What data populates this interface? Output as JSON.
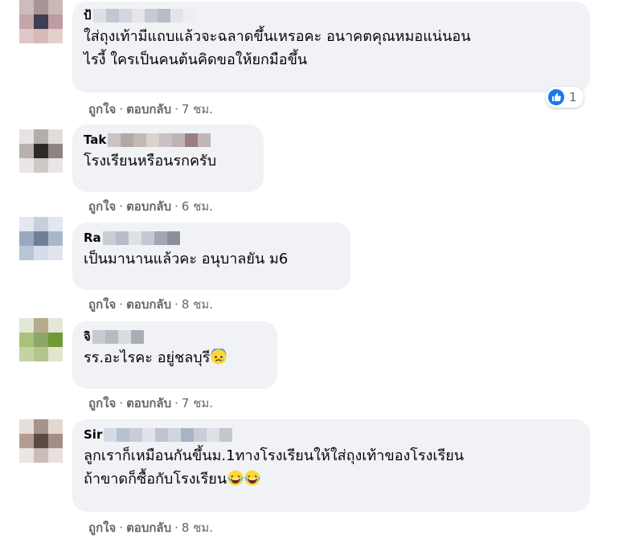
{
  "comments": [
    {
      "name": "ป้",
      "text_line1": "ใส่ถุงเท้ามีแถบแล้วจะฉลาดขึ้นเหรอคะ อนาคตคุณหมอแน่นอน",
      "text_line2": "ไรงี้ ใครเป็นคนต้นคิดขอให้ยกมือขึ้น",
      "like": "ถูกใจ",
      "reply": "ตอบกลับ",
      "time": "7 ชม.",
      "reaction_count": "1"
    },
    {
      "name": "Tak",
      "text_line1": "โรงเรียนหรือนรกครับ",
      "like": "ถูกใจ",
      "reply": "ตอบกลับ",
      "time": "6 ชม."
    },
    {
      "name": "Ra",
      "text_line1": "เป็นมานานแล้วคะ อนุบาลยัน ม6",
      "like": "ถูกใจ",
      "reply": "ตอบกลับ",
      "time": "8 ชม."
    },
    {
      "name": "จิ",
      "text_line1": "รร.อะไรคะ อยู่ชลบุรี",
      "like": "ถูกใจ",
      "reply": "ตอบกลับ",
      "time": "7 ชม."
    },
    {
      "name": "Sir",
      "text_line1": "ลูกเราก็เหมือนกันขึ้นม.1ทางโรงเรียนให้ใส่ถุงเท้าของโรงเรียน",
      "text_line2": "ถ้าขาดก็ซื้อกับโรงเรียน",
      "like": "ถูกใจ",
      "reply": "ตอบกลับ",
      "time": "8 ชม."
    }
  ],
  "icons": {
    "reaction": "thumbs-up-icon",
    "emoji_anxious": "anxious-face-icon",
    "emoji_laughing": "crying-laughing-face-icon"
  },
  "colors": {
    "bubble": "#f0f2f5",
    "meta": "#65676b",
    "like_blue": "#1877f2"
  }
}
